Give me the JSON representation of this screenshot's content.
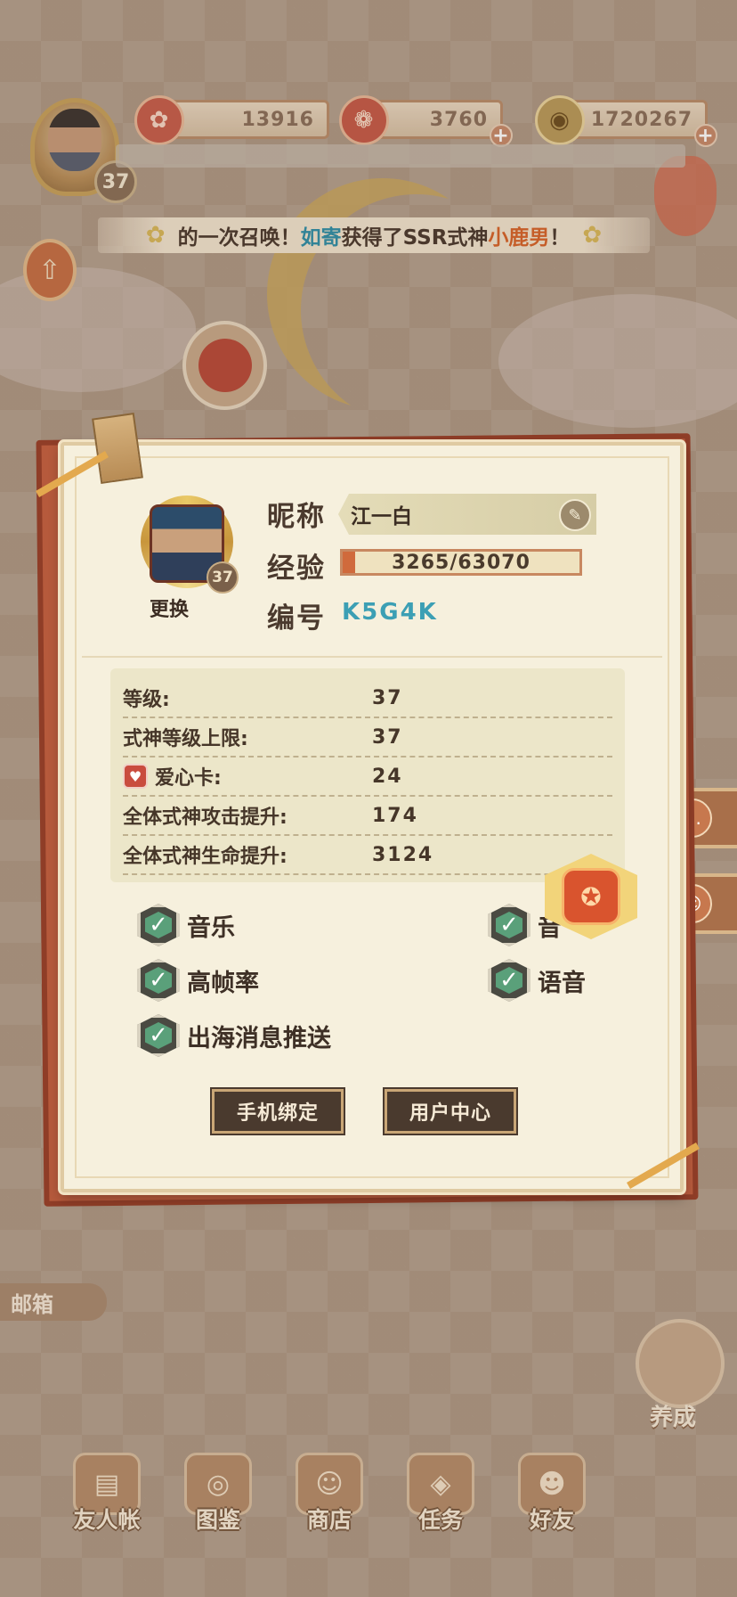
{
  "hud": {
    "player_level": "37",
    "resources": [
      {
        "value": "13916",
        "icon": "magatama-icon"
      },
      {
        "value": "3760",
        "icon": "jade-icon"
      },
      {
        "value": "1720267",
        "icon": "coin-icon"
      }
    ],
    "plus_symbol": "+"
  },
  "marquee": {
    "text_before": "的一次召唤！",
    "player": "如寄",
    "text_middle": "获得了SSR式神",
    "shikigami": "小鹿男",
    "text_after": "！"
  },
  "profile": {
    "avatar_level": "37",
    "change_label": "更换",
    "nickname_label": "昵称",
    "nickname": "江一白",
    "exp_label": "经验",
    "exp_current": 3265,
    "exp_max": 63070,
    "exp_text": "3265/63070",
    "id_label": "编号",
    "id_value": "K5G4K"
  },
  "stats": [
    {
      "label": "等级:",
      "value": "37"
    },
    {
      "label": "式神等级上限:",
      "value": "37"
    },
    {
      "label": "爱心卡:",
      "value": "24",
      "icon": "heart-card-icon"
    },
    {
      "label": "全体式神攻击提升:",
      "value": "174"
    },
    {
      "label": "全体式神生命提升:",
      "value": "3124"
    }
  ],
  "options": {
    "music": {
      "label": "音乐",
      "checked": true
    },
    "sound_partial": {
      "label": "音",
      "checked": true
    },
    "high_fps": {
      "label": "高帧率",
      "checked": true
    },
    "voice": {
      "label": "语音",
      "checked": true
    },
    "push": {
      "label": "出海消息推送",
      "checked": true
    }
  },
  "buttons": {
    "phone_bind": "手机绑定",
    "user_center": "用户中心"
  },
  "side": {
    "mailbox": "邮箱",
    "grow": "养成"
  },
  "nav": [
    {
      "label": "友人帐",
      "icon": "friend-book-icon"
    },
    {
      "label": "图鉴",
      "icon": "eye-book-icon"
    },
    {
      "label": "商店",
      "icon": "lucky-cat-icon"
    },
    {
      "label": "任务",
      "icon": "task-icon"
    },
    {
      "label": "好友",
      "icon": "friends-icon"
    }
  ],
  "colors": {
    "panel_bg": "#f6f0dd",
    "panel_frame": "#b65a3c",
    "id_accent": "#3c9fb4",
    "exp_fill": "#d06a3c",
    "check_green": "#5aa07a"
  }
}
